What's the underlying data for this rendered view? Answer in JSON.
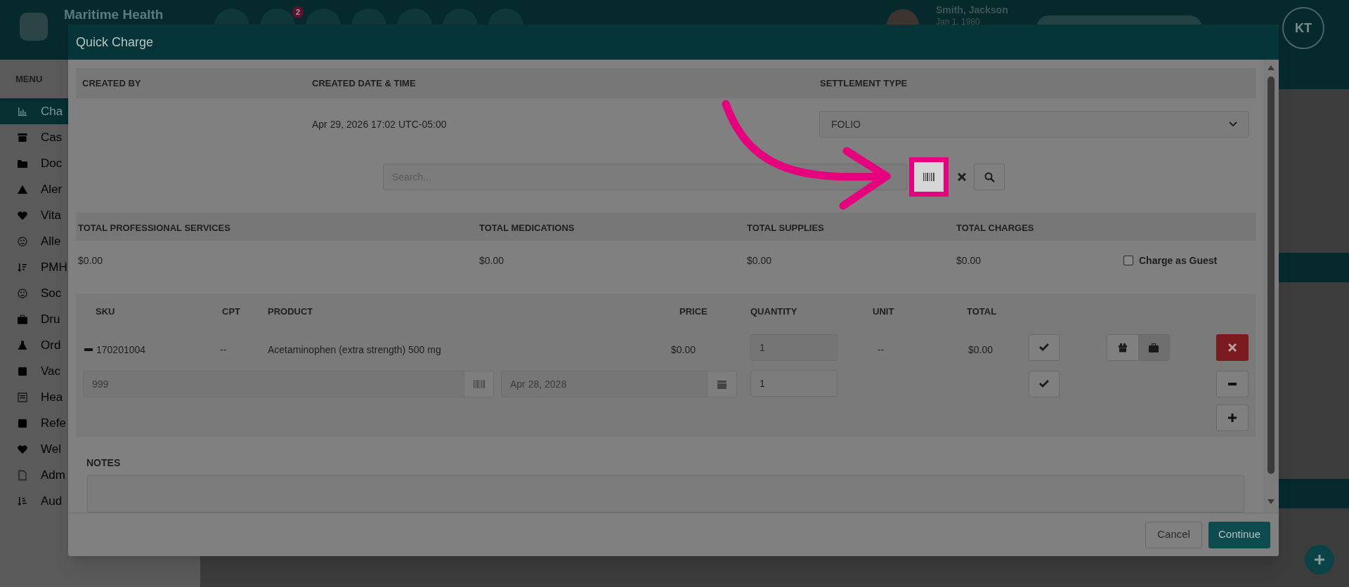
{
  "app_header": {
    "title": "Maritime Health",
    "nav_badge": "2",
    "patient_name": "Smith, Jackson",
    "patient_dob": "Jan 1, 1980",
    "user_initials": "KT"
  },
  "sidebar": {
    "menu_label": "MENU",
    "items": [
      {
        "label": "Cha",
        "selected": true
      },
      {
        "label": "Cas",
        "selected": false
      },
      {
        "label": "Doc",
        "selected": false
      },
      {
        "label": "Aler",
        "selected": false
      },
      {
        "label": "Vita",
        "selected": false
      },
      {
        "label": "Alle",
        "selected": false
      },
      {
        "label": "PMH",
        "selected": false
      },
      {
        "label": "Soc",
        "selected": false
      },
      {
        "label": "Dru",
        "selected": false
      },
      {
        "label": "Ord",
        "selected": false
      },
      {
        "label": "Vac",
        "selected": false
      },
      {
        "label": "Hea",
        "selected": false
      },
      {
        "label": "Refe",
        "selected": false
      },
      {
        "label": "Wel",
        "selected": false
      },
      {
        "label": "Adm",
        "selected": false
      },
      {
        "label": "Aud",
        "selected": false
      }
    ]
  },
  "modal": {
    "title": "Quick Charge",
    "info_columns": [
      "CREATED BY",
      "CREATED DATE & TIME",
      "SETTLEMENT TYPE"
    ],
    "created_datetime": "Apr 29, 2026 17:02 UTC-05:00",
    "settlement_type": "FOLIO",
    "search": {
      "placeholder": "Search..."
    },
    "totals": [
      {
        "label": "TOTAL PROFESSIONAL SERVICES",
        "value": "$0.00"
      },
      {
        "label": "TOTAL MEDICATIONS",
        "value": "$0.00"
      },
      {
        "label": "TOTAL SUPPLIES",
        "value": "$0.00"
      },
      {
        "label": "TOTAL CHARGES",
        "value": "$0.00"
      }
    ],
    "charge_as_guest": {
      "label": "Charge as Guest",
      "checked": false
    },
    "items": {
      "columns": [
        "SKU",
        "CPT",
        "PRODUCT",
        "PRICE",
        "QUANTITY",
        "UNIT",
        "TOTAL"
      ],
      "row": {
        "sku": "170201004",
        "cpt": "--",
        "product": "Acetaminophen (extra strength) 500 mg",
        "price": "$0.00",
        "quantity": "1",
        "unit": "--",
        "total": "$0.00"
      },
      "lot": {
        "lot_number": "999",
        "expiry": "Apr 28, 2028",
        "quantity": "1"
      }
    },
    "notes_label": "NOTES",
    "buttons": [
      "Cancel",
      "Continue"
    ]
  }
}
